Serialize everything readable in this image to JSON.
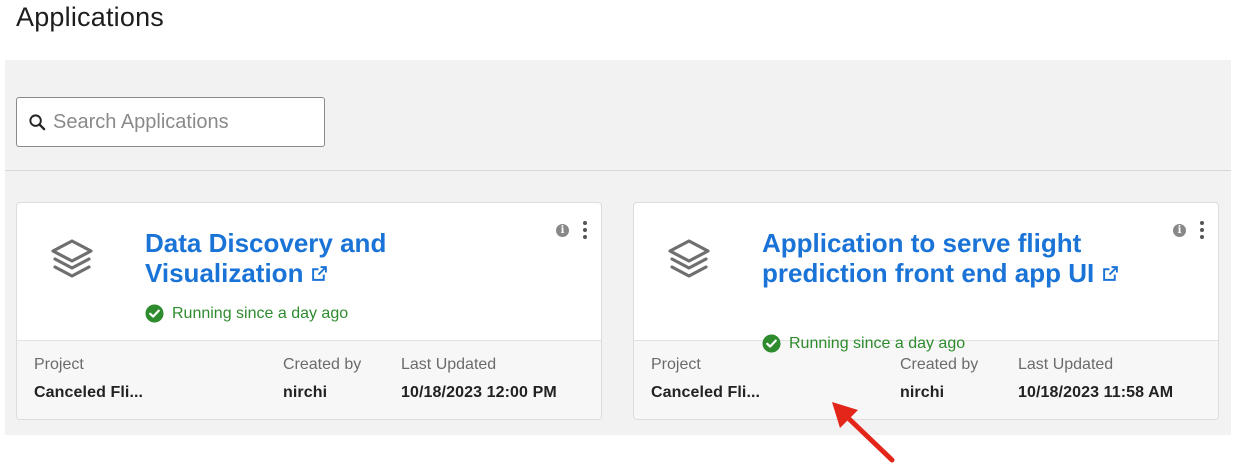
{
  "page": {
    "title": "Applications"
  },
  "search": {
    "placeholder": "Search Applications"
  },
  "footer_labels": {
    "project": "Project",
    "created_by": "Created by",
    "last_updated": "Last Updated"
  },
  "applications": [
    {
      "title": "Data Discovery and Visualization",
      "status": "Running since a day ago",
      "project": "Canceled Fli...",
      "created_by": "nirchi",
      "last_updated": "10/18/2023 12:00 PM"
    },
    {
      "title": "Application to serve flight prediction front end app UI",
      "status": "Running since a day ago",
      "project": "Canceled Fli...",
      "created_by": "nirchi",
      "last_updated": "10/18/2023 11:58 AM"
    }
  ],
  "colors": {
    "title_link": "#1a73d6",
    "status_running": "#2e8b2e",
    "annotation_arrow": "#e32619"
  },
  "icons": [
    "search-icon",
    "layers-icon",
    "external-link-icon",
    "check-circle-icon",
    "info-icon",
    "kebab-menu-icon"
  ]
}
